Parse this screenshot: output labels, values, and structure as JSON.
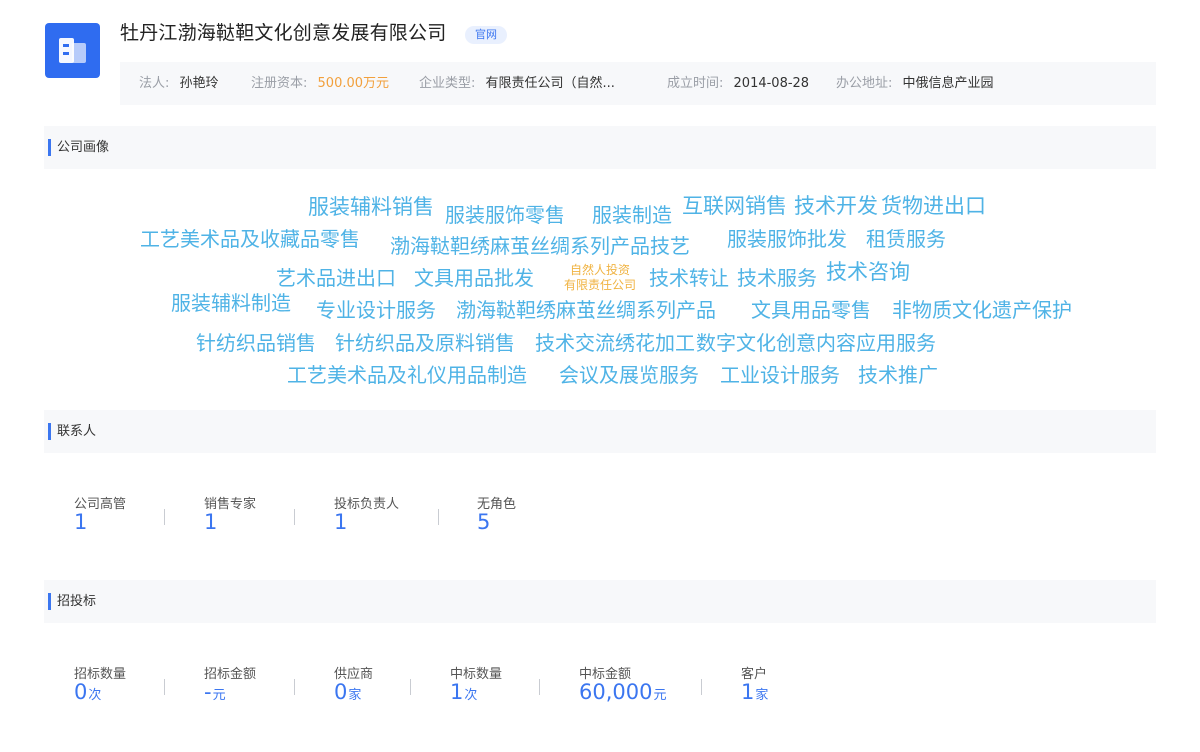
{
  "company": {
    "name": "牡丹江渤海鞑靼文化创意发展有限公司",
    "badge": "官网"
  },
  "info": {
    "legal_person_label": "法人:",
    "legal_person": "孙艳玲",
    "capital_label": "注册资本:",
    "capital": "500.00万元",
    "type_label": "企业类型:",
    "type": "有限责任公司（自然...",
    "founded_label": "成立时间:",
    "founded": "2014-08-28",
    "address_label": "办公地址:",
    "address": "中俄信息产业园"
  },
  "sections": {
    "portrait": "公司画像",
    "contacts": "联系人",
    "bidding": "招投标"
  },
  "word_cloud": {
    "words": [
      "服装辅料销售",
      "服装服饰零售",
      "服装制造",
      "互联网销售",
      "技术开发",
      "货物进出口",
      "工艺美术品及收藏品零售",
      "渤海鞑靼绣麻茧丝绸系列产品技艺",
      "服装服饰批发",
      "租赁服务",
      "艺术品进出口",
      "文具用品批发",
      "技术转让",
      "技术服务",
      "技术咨询",
      "服装辅料制造",
      "专业设计服务",
      "渤海鞑靼绣麻茧丝绸系列产品",
      "文具用品零售",
      "非物质文化遗产保护",
      "针纺织品销售",
      "针纺织品及原料销售",
      "技术交流",
      "绣花加工",
      "数字文化创意内容应用服务",
      "工艺美术品及礼仪用品制造",
      "会议及展览服务",
      "工业设计服务",
      "技术推广"
    ],
    "small_line1": "自然人投资",
    "small_line2": "有限责任公司"
  },
  "contacts": {
    "stats": [
      {
        "label": "公司高管",
        "value": "1"
      },
      {
        "label": "销售专家",
        "value": "1"
      },
      {
        "label": "投标负责人",
        "value": "1"
      },
      {
        "label": "无角色",
        "value": "5"
      }
    ]
  },
  "bidding": {
    "stats": [
      {
        "label": "招标数量",
        "value": "0",
        "unit": "次"
      },
      {
        "label": "招标金额",
        "value": "-",
        "unit": "元"
      },
      {
        "label": "供应商",
        "value": "0",
        "unit": "家"
      },
      {
        "label": "中标数量",
        "value": "1",
        "unit": "次"
      },
      {
        "label": "中标金额",
        "value": "60,000",
        "unit": "元"
      },
      {
        "label": "客户",
        "value": "1",
        "unit": "家"
      }
    ]
  },
  "colors": {
    "accent": "#3b76f0",
    "cloud": "#4fb3e6",
    "orange": "#f2a03c"
  }
}
